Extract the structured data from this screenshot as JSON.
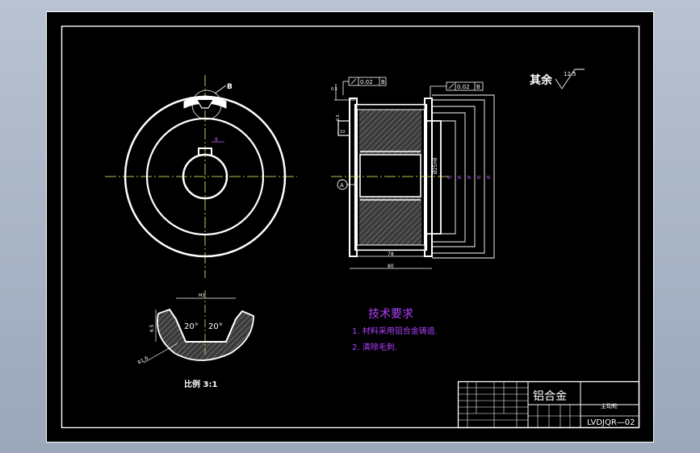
{
  "drawing": {
    "roughness_note": "其余",
    "roughness_value": "12.5",
    "detail_callout": "B",
    "scale_label": "比例 3:1",
    "angle_left": "20°",
    "angle_right": "20°",
    "dim_depth": "6.5",
    "dim_top": "M3",
    "dim_radius": "R1.6",
    "tolerance_left": "0.02",
    "tolerance_left_datum": "B",
    "tolerance_right": "0.02",
    "tolerance_right_datum": "B",
    "bore_dim": "Ø25H8",
    "dim_width_inner": "78",
    "dim_width_outer": "80",
    "dim_flange_1": "10",
    "dim_flange_2": "6.5",
    "dim_left_small": "0.5",
    "dim_keyway": "8",
    "datum_a": "A",
    "section_diameters": [
      "Ø",
      "Ø",
      "Ø",
      "Ø",
      "Ø"
    ]
  },
  "requirements": {
    "heading": "技术要求",
    "items": [
      "1. 材料采用铝合金铸造.",
      "2. 清除毛刺."
    ]
  },
  "title_block": {
    "material": "铝合金",
    "part_name": "主动轮",
    "drawing_no": "LVDJQR—02"
  },
  "colors": {
    "paper": "#000000",
    "line": "#ffffff",
    "centerline": "#ffff66",
    "annotation": "#b040ff",
    "dimension": "#c060ff"
  }
}
